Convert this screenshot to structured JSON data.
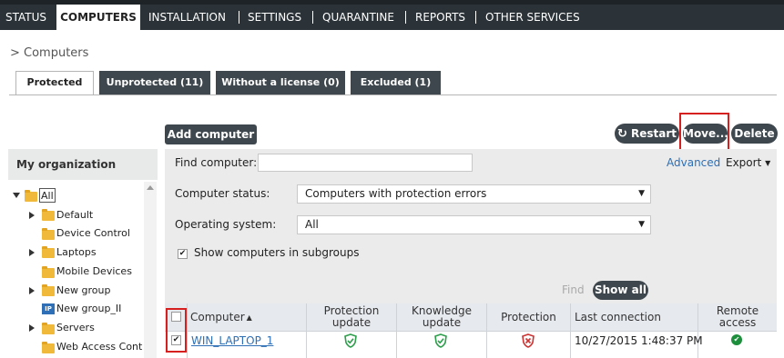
{
  "nav": {
    "items": [
      "STATUS",
      "COMPUTERS",
      "INSTALLATION",
      "SETTINGS",
      "QUARANTINE",
      "REPORTS",
      "OTHER SERVICES"
    ]
  },
  "breadcrumb": "> Computers",
  "tabs": [
    "Protected",
    "Unprotected (11)",
    "Without a license (0)",
    "Excluded (1)"
  ],
  "toolbar": {
    "add_computer": "Add computer",
    "restart": "Restart",
    "move": "Move...",
    "delete": "Delete"
  },
  "sidebar": {
    "title": "My organization",
    "items": [
      "All",
      "Default",
      "Device Control",
      "Laptops",
      "Mobile Devices",
      "New group",
      "New group_II",
      "Servers",
      "Web Access Cont"
    ]
  },
  "filters": {
    "find_label": "Find computer:",
    "find_value": "",
    "advanced": "Advanced",
    "export": "Export",
    "status_label": "Computer status:",
    "status_value": "Computers with protection errors",
    "os_label": "Operating system:",
    "os_value": "All",
    "subgroups_label": "Show computers in subgroups",
    "find_link": "Find",
    "show_all": "Show all"
  },
  "table": {
    "headers": {
      "computer": "Computer",
      "protection_update_1": "Protection",
      "protection_update_2": "update",
      "knowledge_update_1": "Knowledge",
      "knowledge_update_2": "update",
      "protection": "Protection",
      "last_connection": "Last connection",
      "remote_access_1": "Remote",
      "remote_access_2": "access"
    },
    "rows": [
      {
        "computer": "WIN_LAPTOP_1",
        "last_connection": "10/27/2015 1:48:37 PM"
      }
    ]
  },
  "colors": {
    "nav_bg": "#2b3338",
    "dark_button": "#3e474d",
    "highlight": "#d62020",
    "ok_green": "#2e9e4c",
    "error_red": "#cc3333",
    "link_blue": "#2e6fb5"
  }
}
